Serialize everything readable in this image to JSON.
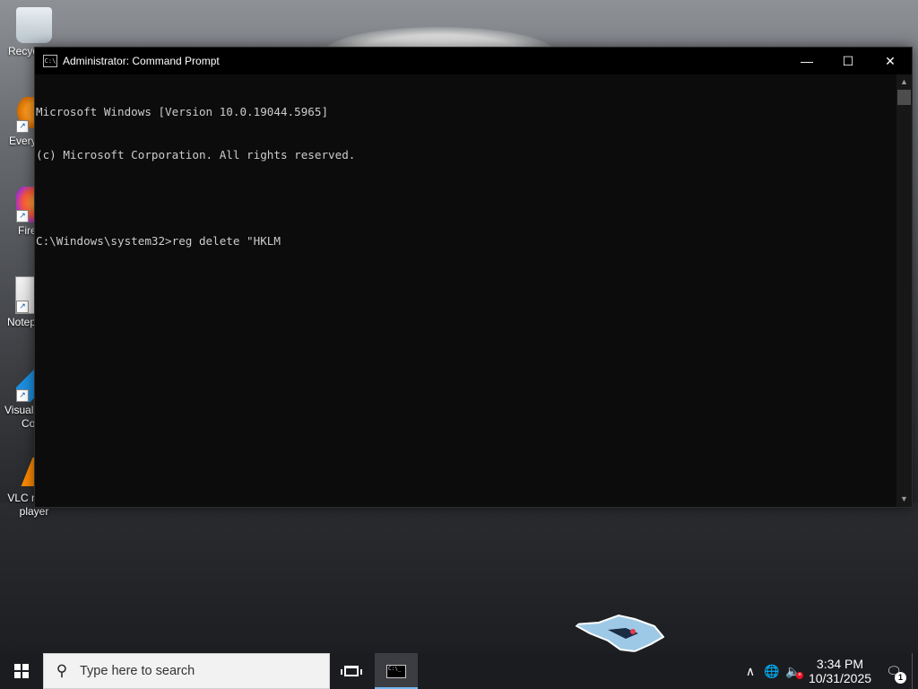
{
  "desktop": {
    "icons": [
      {
        "label": "Recycle Bin",
        "visible_label": "Recyc",
        "icon": "recycle-bin-icon"
      },
      {
        "label": "Everything",
        "visible_label": "Every",
        "icon": "everything-icon"
      },
      {
        "label": "Firefox",
        "visible_label": "Fire",
        "icon": "firefox-icon"
      },
      {
        "label": "Notepad++",
        "visible_label": "Notep",
        "icon": "notepad-icon"
      },
      {
        "label": "Visual Studio Code",
        "visible_label_line1": "Visual",
        "visible_label_line2": "Co",
        "icon": "vscode-icon"
      },
      {
        "label": "VLC media player",
        "visible_label_line1": "VLC media",
        "visible_label_line2": "player",
        "icon": "vlc-icon"
      }
    ]
  },
  "window": {
    "title": "Administrator: Command Prompt",
    "icon": "cmd-icon",
    "controls": {
      "minimize": "—",
      "maximize": "☐",
      "close": "✕"
    },
    "console_lines": [
      "Microsoft Windows [Version 10.0.19044.5965]",
      "(c) Microsoft Corporation. All rights reserved.",
      "",
      "C:\\Windows\\system32>reg delete \"HKLM"
    ]
  },
  "taskbar": {
    "search_placeholder": "Type here to search",
    "active_app": "Command Prompt",
    "tray": {
      "time": "3:34 PM",
      "date": "10/31/2025",
      "notification_count": "1",
      "volume_muted": true
    }
  }
}
